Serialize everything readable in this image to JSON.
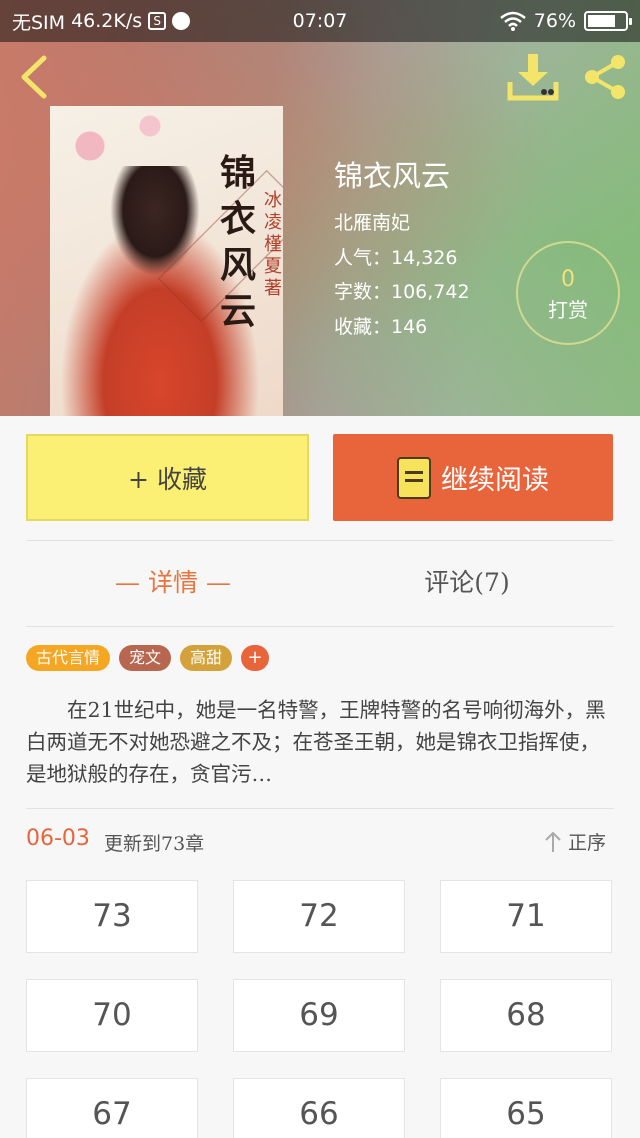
{
  "status_bar": {
    "carrier": "无SIM",
    "speed": "46.2K/s",
    "time": "07:07",
    "battery": "76%",
    "battery_level": 0.76
  },
  "book": {
    "title": "锦衣风云",
    "author": "北雁南妃",
    "popularity": "人气：14,326",
    "word_count": "字数：106,742",
    "favorites": "收藏：146",
    "cover_title": "锦衣风云",
    "cover_author": "冰凌槿夏著"
  },
  "reward": {
    "count": "0",
    "label": "打赏"
  },
  "actions": {
    "favorite": "+ 收藏",
    "continue_reading": "继续阅读"
  },
  "tabs": {
    "detail": "— 详情 —",
    "comments": "评论(7)"
  },
  "tags": [
    {
      "label": "古代言情",
      "color": "#f5a623"
    },
    {
      "label": "宠文",
      "color": "#b8664f"
    },
    {
      "label": "高甜",
      "color": "#d4a23a"
    }
  ],
  "tag_more": "+",
  "synopsis": "在21世纪中，她是一名特警，王牌特警的名号响彻海外，黑白两道无不对她恐避之不及；在苍圣王朝，她是锦衣卫指挥使，是地狱般的存在，贪官污…",
  "update": {
    "date": "06-03",
    "text": "更新到73章",
    "sort_label": "正序"
  },
  "chapters": [
    "73",
    "72",
    "71",
    "70",
    "69",
    "68",
    "67",
    "66",
    "65"
  ],
  "colors": {
    "accent": "#e8653c",
    "favorite_button": "#fbf074"
  }
}
